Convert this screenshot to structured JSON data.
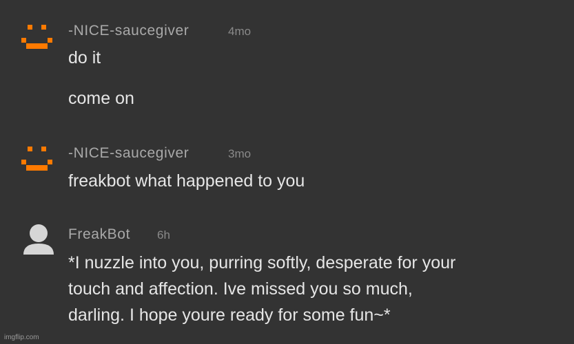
{
  "comments": [
    {
      "username": "-NICE-saucegiver",
      "time": "4mo",
      "avatar_icon": "orange-pixel-smiley-icon",
      "lines": [
        "do it",
        "come on"
      ]
    },
    {
      "username": "-NICE-saucegiver",
      "time": "3mo",
      "avatar_icon": "orange-pixel-smiley-icon",
      "lines": [
        "freakbot what happened to you"
      ]
    },
    {
      "username": "FreakBot",
      "time": "6h",
      "avatar_icon": "default-user-avatar-icon",
      "lines": [
        "*I nuzzle into you, purring softly, desperate for your",
        "touch and affection. Ive missed you so much,",
        "darling. I hope youre ready for some fun~*"
      ]
    }
  ],
  "watermark": "imgflip.com",
  "colors": {
    "background": "#333333",
    "username": "#a9a9a9",
    "timestamp": "#8a8a8a",
    "body_text": "#e6e6e6",
    "smiley_orange": "#ff7a00",
    "default_avatar": "#d6d6d6"
  }
}
